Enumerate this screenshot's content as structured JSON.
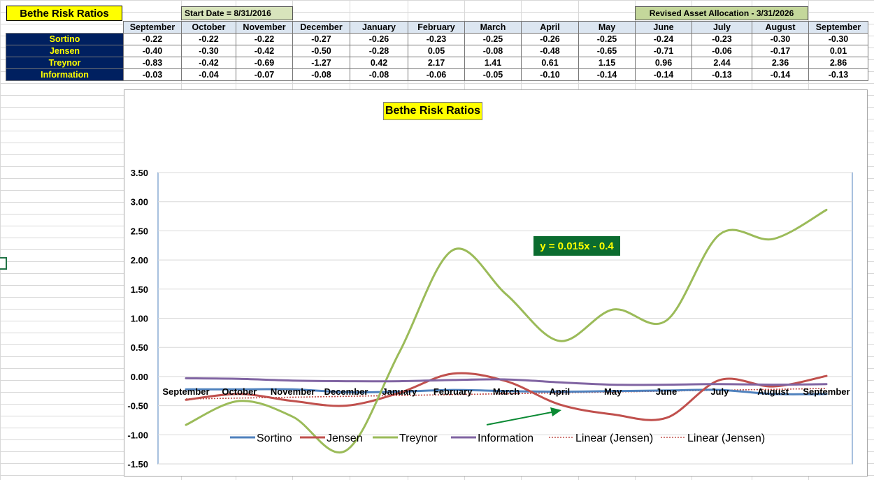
{
  "header": {
    "title": "Bethe Risk Ratios",
    "start_date": "Start Date = 8/31/2016",
    "revised": "Revised Asset Allocation - 3/31/2026"
  },
  "table": {
    "columns": [
      "September",
      "October",
      "November",
      "December",
      "January",
      "February",
      "March",
      "April",
      "May",
      "June",
      "July",
      "August",
      "September"
    ],
    "rows": [
      {
        "label": "Sortino",
        "values": [
          "-0.22",
          "-0.22",
          "-0.22",
          "-0.27",
          "-0.26",
          "-0.23",
          "-0.25",
          "-0.26",
          "-0.25",
          "-0.24",
          "-0.23",
          "-0.30",
          "-0.30"
        ]
      },
      {
        "label": "Jensen",
        "values": [
          "-0.40",
          "-0.30",
          "-0.42",
          "-0.50",
          "-0.28",
          "0.05",
          "-0.08",
          "-0.48",
          "-0.65",
          "-0.71",
          "-0.06",
          "-0.17",
          "0.01"
        ]
      },
      {
        "label": "Treynor",
        "values": [
          "-0.83",
          "-0.42",
          "-0.69",
          "-1.27",
          "0.42",
          "2.17",
          "1.41",
          "0.61",
          "1.15",
          "0.96",
          "2.44",
          "2.36",
          "2.86"
        ]
      },
      {
        "label": "Information",
        "values": [
          "-0.03",
          "-0.04",
          "-0.07",
          "-0.08",
          "-0.08",
          "-0.06",
          "-0.05",
          "-0.10",
          "-0.14",
          "-0.14",
          "-0.13",
          "-0.14",
          "-0.13"
        ]
      }
    ]
  },
  "chart_data": {
    "type": "line",
    "title": "Bethe Risk Ratios",
    "categories": [
      "September",
      "October",
      "November",
      "December",
      "January",
      "February",
      "March",
      "April",
      "May",
      "June",
      "July",
      "August",
      "September"
    ],
    "series": [
      {
        "name": "Sortino",
        "color": "#4f81bd",
        "values": [
          -0.22,
          -0.22,
          -0.22,
          -0.27,
          -0.26,
          -0.23,
          -0.25,
          -0.26,
          -0.25,
          -0.24,
          -0.23,
          -0.3,
          -0.3
        ]
      },
      {
        "name": "Jensen",
        "color": "#c0504d",
        "values": [
          -0.4,
          -0.3,
          -0.42,
          -0.5,
          -0.28,
          0.05,
          -0.08,
          -0.48,
          -0.65,
          -0.71,
          -0.06,
          -0.17,
          0.01
        ]
      },
      {
        "name": "Treynor",
        "color": "#9bbb59",
        "values": [
          -0.83,
          -0.42,
          -0.69,
          -1.27,
          0.42,
          2.17,
          1.41,
          0.61,
          1.15,
          0.96,
          2.44,
          2.36,
          2.86
        ]
      },
      {
        "name": "Information",
        "color": "#8064a2",
        "values": [
          -0.03,
          -0.04,
          -0.07,
          -0.08,
          -0.08,
          -0.06,
          -0.05,
          -0.1,
          -0.14,
          -0.14,
          -0.13,
          -0.14,
          -0.13
        ]
      }
    ],
    "trendlines": [
      {
        "name": "Linear (Jensen)",
        "color": "#c0504d",
        "slope": 0.015,
        "intercept": -0.4
      },
      {
        "name": "Linear (Jensen)",
        "color": "#c0504d",
        "slope": 0.015,
        "intercept": -0.4
      }
    ],
    "trend_label": "y = 0.015x - 0.4",
    "yticks": [
      "3.50",
      "3.00",
      "2.50",
      "2.00",
      "1.50",
      "1.00",
      "0.50",
      "0.00",
      "-0.50",
      "-1.00",
      "-1.50"
    ],
    "ylim": [
      -1.5,
      3.5
    ],
    "grid": true,
    "legend": "bottom"
  }
}
